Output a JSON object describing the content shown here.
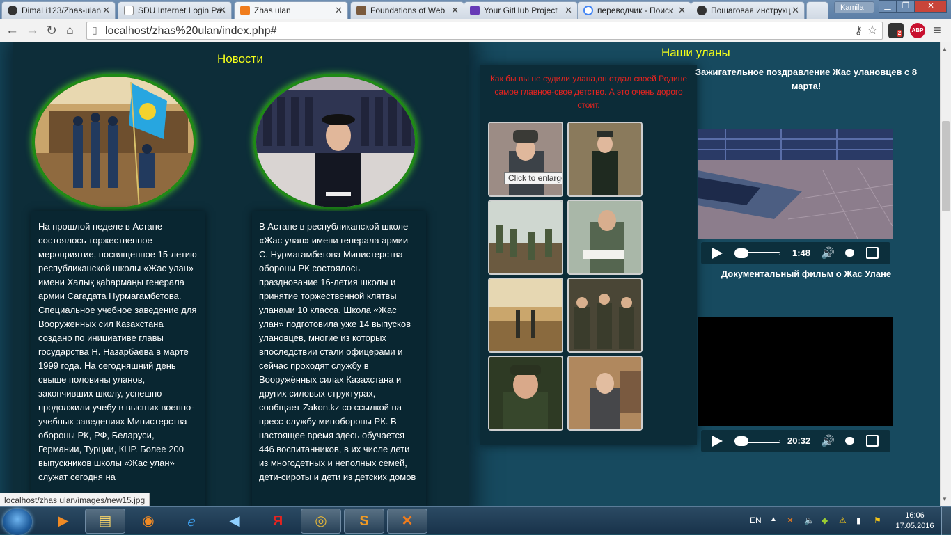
{
  "browser": {
    "tabs": [
      {
        "label": "DimaLi123/Zhas-ulan",
        "favicon": "github-icon",
        "color": "#333333"
      },
      {
        "label": "SDU Internet Login Pa",
        "favicon": "page-icon",
        "color": "#ffffff"
      },
      {
        "label": "Zhas ulan",
        "favicon": "xampp-icon",
        "color": "#f07c1c",
        "active": true
      },
      {
        "label": "Foundations of Web",
        "favicon": "course-icon",
        "color": "#7a5a3c"
      },
      {
        "label": "Your GitHub Project",
        "favicon": "form-icon",
        "color": "#673ab7"
      },
      {
        "label": "переводчик - Поиск",
        "favicon": "google-icon",
        "color": "#4285f4"
      },
      {
        "label": "Пошаговая инструкц",
        "favicon": "github-icon",
        "color": "#333333"
      }
    ],
    "user": "Kamila",
    "url": "localhost/zhas%20ulan/index.php#",
    "extensions": {
      "badge_count": "2",
      "adblock_label": "ABP"
    },
    "status_url": "localhost/zhas ulan/images/new15.jpg"
  },
  "page": {
    "news_title": "Новости",
    "ulans_title": "Наши уланы",
    "news": [
      {
        "image_alt": "ceremony-with-flag",
        "text": "На прошлой неделе в Астане состоялось торжественное мероприятие, посвященное 15-летию республиканской школы «Жас улан» имени Халық қаһармаңы генерала армии Сагадата Нурмагамбетова. Специальное учебное заведение для Вооруженных сил Казахстана создано по инициативе главы государства Н. Назарбаева в марте 1999 года. На сегодняшний день свыше половины уланов, закончивших школу, успешно продолжили учебу в высших военно-учебных заведениях Министерства обороны РК, РФ, Беларуси, Германии, Турции, КНР. Более 200 выпускников школы «Жас улан» служат сегодня на"
      },
      {
        "image_alt": "cadet-in-formation",
        "text": "В Астане в республиканской школе «Жас улан» имени генерала армии С. Нурмагамбетова Министерства обороны РК состоялось празднование 16-летия школы и принятие торжественной клятвы уланами 10 класса. Школа «Жас улан» подготовила уже 14 выпусков улановцев, многие из которых впоследствии стали офицерами и сейчас проходят службу в Вооружённых силах Казахстана и других силовых структурах, сообщает Zakon.kz со ссылкой на пресс-службу минобороны РК. В настоящее время здесь обучается 446 воспитанников, в их числе дети из многодетных и неполных семей, дети-сироты и дети из детских домов"
      }
    ],
    "gallery": {
      "quote": "Как бы вы не судили улана,он отдал своей Родине самое главное-свое детство. А это очень дорого стоит.",
      "tooltip": "Click to enlarge",
      "thumbs": [
        "cadet-in-hat",
        "cadet-standing",
        "classroom",
        "student-reading",
        "hall-formation",
        "cadets-in-hats",
        "smiling-cadet",
        "young-cadet-coat"
      ]
    },
    "videos": [
      {
        "title": "Зажигательное поздравление Жас улановцев с 8 марта!",
        "time": "1:48",
        "progress": 0.0
      },
      {
        "title": "Документальный фильм о Жас Улане",
        "time": "20:32",
        "progress": 0.0
      }
    ]
  },
  "taskbar": {
    "apps": [
      "media-player-icon",
      "explorer-icon",
      "firefox-icon",
      "ie-icon",
      "sound-app-icon",
      "yandex-icon",
      "chrome-icon",
      "sublime-icon",
      "xampp-icon"
    ],
    "language": "EN",
    "time": "16:06",
    "date": "17.05.2016"
  },
  "colors": {
    "page_bg": "#174a5f",
    "panel_bg": "#0d2d39",
    "title": "#f5ff1a",
    "quote": "#e8231f",
    "circle_border": "#1f8a16"
  }
}
